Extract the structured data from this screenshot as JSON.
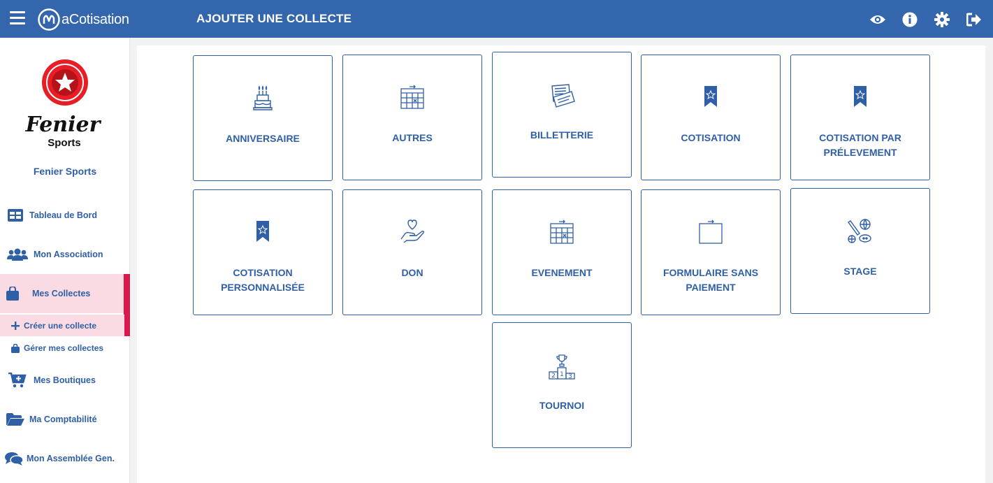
{
  "app": {
    "brand": "aCotisation",
    "page_title": "AJOUTER UNE COLLECTE"
  },
  "topbar_icons": [
    "eye-icon",
    "info-icon",
    "gear-icon",
    "logout-icon"
  ],
  "club": {
    "logo_text_1": "Fenier",
    "logo_text_2": "Sports",
    "name": "Fenier Sports"
  },
  "sidebar": {
    "items": [
      {
        "label": "Tableau de Bord",
        "icon": "dashboard-icon"
      },
      {
        "label": "Mon Association",
        "icon": "users-icon"
      },
      {
        "label": "Mes Collectes",
        "icon": "bag-icon"
      },
      {
        "label": "Mes Boutiques",
        "icon": "cart-icon"
      },
      {
        "label": "Ma Comptabilité",
        "icon": "folder-icon"
      },
      {
        "label": "Mon Assemblée Gen.",
        "icon": "comments-icon"
      }
    ],
    "sub_items": [
      {
        "label": "Créer une collecte",
        "icon": "plus-icon"
      },
      {
        "label": "Gérer mes collectes",
        "icon": "bag-icon"
      }
    ]
  },
  "accent_color": "#d91a4f",
  "brand_color": "#3466ad",
  "cards": [
    {
      "label": "ANNIVERSAIRE",
      "icon": "cake-icon"
    },
    {
      "label": "AUTRES",
      "icon": "calendar-icon"
    },
    {
      "label": "BILLETTERIE",
      "icon": "ticket-icon"
    },
    {
      "label": "COTISATION",
      "icon": "ribbon-star-icon"
    },
    {
      "label": "COTISATION PAR PRÉLEVEMENT",
      "icon": "ribbon-star-icon"
    },
    {
      "label": "COTISATION PERSONNALISÉE",
      "icon": "ribbon-star-icon"
    },
    {
      "label": "DON",
      "icon": "hand-heart-icon"
    },
    {
      "label": "EVENEMENT",
      "icon": "calendar-icon"
    },
    {
      "label": "FORMULAIRE SANS PAIEMENT",
      "icon": "blank-form-icon"
    },
    {
      "label": "STAGE",
      "icon": "sports-icon"
    },
    {
      "label": "TOURNOI",
      "icon": "podium-icon"
    }
  ]
}
